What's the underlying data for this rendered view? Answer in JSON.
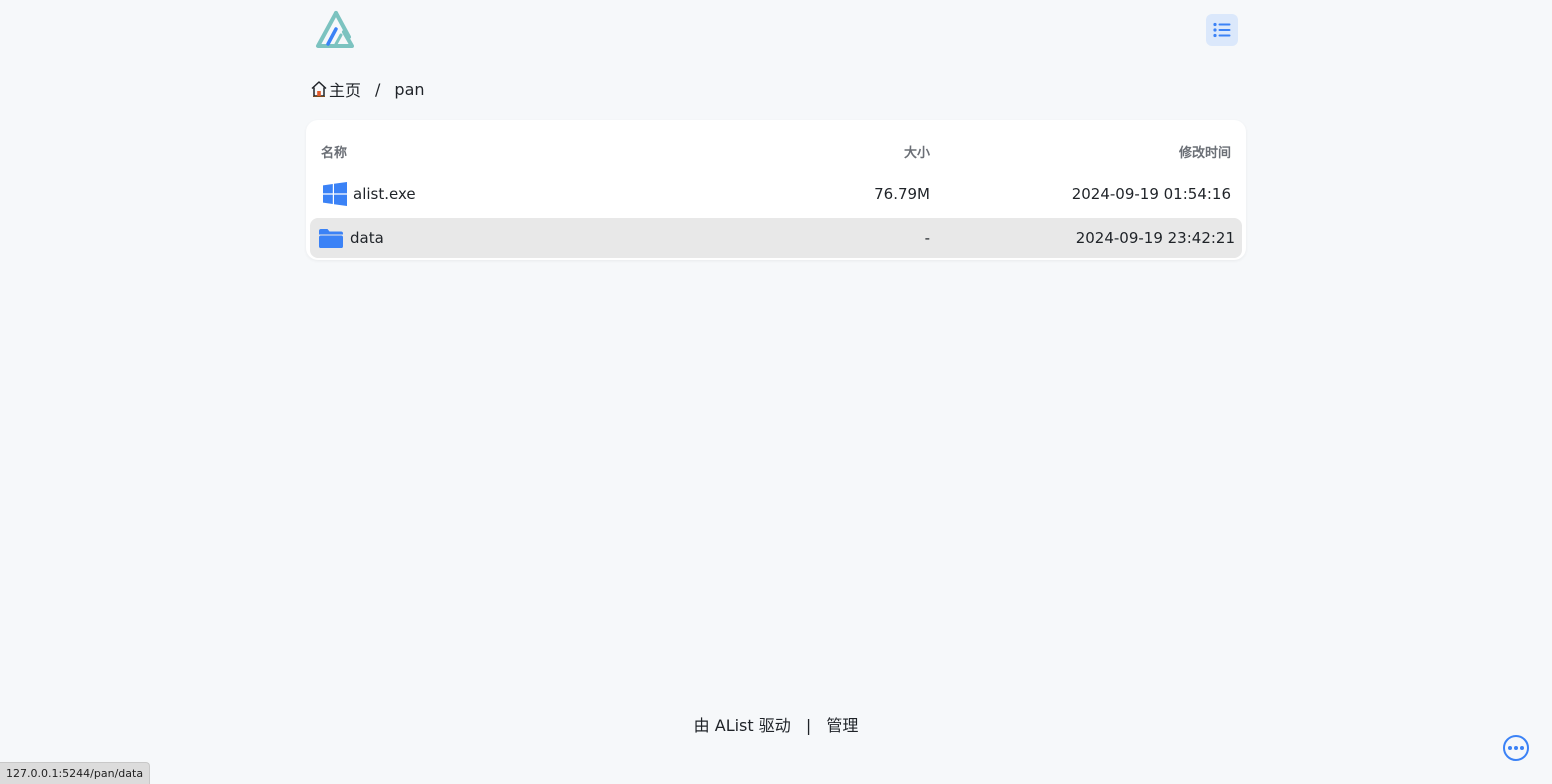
{
  "header": {
    "logo_icon": "alist-logo-icon",
    "layout_toggle_icon": "list-icon"
  },
  "breadcrumb": {
    "home_label": "主页",
    "separator": "/",
    "items": [
      "pan"
    ]
  },
  "file_list": {
    "columns": {
      "name": "名称",
      "size": "大小",
      "modified": "修改时间"
    },
    "rows": [
      {
        "icon": "windows-icon",
        "name": "alist.exe",
        "size": "76.79M",
        "modified": "2024-09-19 01:54:16"
      },
      {
        "icon": "folder-icon",
        "name": "data",
        "size": "-",
        "modified": "2024-09-19 23:42:21"
      }
    ]
  },
  "footer": {
    "powered_by": "由 AList 驱动",
    "separator": "|",
    "manage_link": "管理"
  },
  "status_bar": {
    "url": "127.0.0.1:5244/pan/data"
  },
  "colors": {
    "accent": "#3b82f6",
    "background": "#f6f8fa",
    "hover_row": "#e8e8e8",
    "logo_teal": "#7cc3c0"
  }
}
